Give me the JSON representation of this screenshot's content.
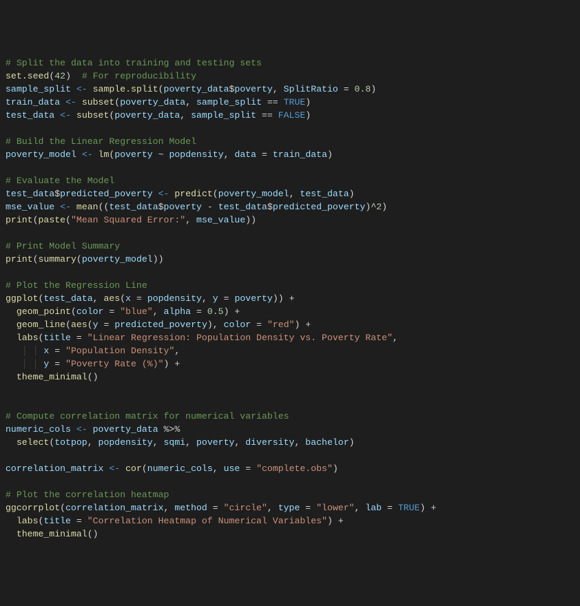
{
  "code": [
    [
      {
        "t": "# Split the data into training and testing sets",
        "c": "comment"
      }
    ],
    [
      {
        "t": "set.seed",
        "c": "func"
      },
      {
        "t": "(",
        "c": "paren"
      },
      {
        "t": "42",
        "c": "num"
      },
      {
        "t": ")",
        "c": "paren"
      },
      {
        "t": "  ",
        "c": "op"
      },
      {
        "t": "# For reproducibility",
        "c": "comment"
      }
    ],
    [
      {
        "t": "sample_split",
        "c": "var"
      },
      {
        "t": " ",
        "c": "op"
      },
      {
        "t": "<-",
        "c": "assign"
      },
      {
        "t": " ",
        "c": "op"
      },
      {
        "t": "sample.split",
        "c": "func"
      },
      {
        "t": "(",
        "c": "paren"
      },
      {
        "t": "poverty_data",
        "c": "var"
      },
      {
        "t": "$",
        "c": "op"
      },
      {
        "t": "poverty",
        "c": "var"
      },
      {
        "t": ", ",
        "c": "op"
      },
      {
        "t": "SplitRatio",
        "c": "var"
      },
      {
        "t": " = ",
        "c": "op"
      },
      {
        "t": "0.8",
        "c": "num"
      },
      {
        "t": ")",
        "c": "paren"
      }
    ],
    [
      {
        "t": "train_data",
        "c": "var"
      },
      {
        "t": " ",
        "c": "op"
      },
      {
        "t": "<-",
        "c": "assign"
      },
      {
        "t": " ",
        "c": "op"
      },
      {
        "t": "subset",
        "c": "func"
      },
      {
        "t": "(",
        "c": "paren"
      },
      {
        "t": "poverty_data",
        "c": "var"
      },
      {
        "t": ", ",
        "c": "op"
      },
      {
        "t": "sample_split",
        "c": "var"
      },
      {
        "t": " == ",
        "c": "op"
      },
      {
        "t": "TRUE",
        "c": "kw"
      },
      {
        "t": ")",
        "c": "paren"
      }
    ],
    [
      {
        "t": "test_data",
        "c": "var"
      },
      {
        "t": " ",
        "c": "op"
      },
      {
        "t": "<-",
        "c": "assign"
      },
      {
        "t": " ",
        "c": "op"
      },
      {
        "t": "subset",
        "c": "func"
      },
      {
        "t": "(",
        "c": "paren"
      },
      {
        "t": "poverty_data",
        "c": "var"
      },
      {
        "t": ", ",
        "c": "op"
      },
      {
        "t": "sample_split",
        "c": "var"
      },
      {
        "t": " == ",
        "c": "op"
      },
      {
        "t": "FALSE",
        "c": "kw"
      },
      {
        "t": ")",
        "c": "paren"
      }
    ],
    [],
    [
      {
        "t": "# Build the Linear Regression Model",
        "c": "comment"
      }
    ],
    [
      {
        "t": "poverty_model",
        "c": "var"
      },
      {
        "t": " ",
        "c": "op"
      },
      {
        "t": "<-",
        "c": "assign"
      },
      {
        "t": " ",
        "c": "op"
      },
      {
        "t": "lm",
        "c": "func"
      },
      {
        "t": "(",
        "c": "paren"
      },
      {
        "t": "poverty",
        "c": "var"
      },
      {
        "t": " ~ ",
        "c": "op"
      },
      {
        "t": "popdensity",
        "c": "var"
      },
      {
        "t": ", ",
        "c": "op"
      },
      {
        "t": "data",
        "c": "var"
      },
      {
        "t": " = ",
        "c": "op"
      },
      {
        "t": "train_data",
        "c": "var"
      },
      {
        "t": ")",
        "c": "paren"
      }
    ],
    [],
    [
      {
        "t": "# Evaluate the Model",
        "c": "comment"
      }
    ],
    [
      {
        "t": "test_data",
        "c": "var"
      },
      {
        "t": "$",
        "c": "op"
      },
      {
        "t": "predicted_poverty",
        "c": "var"
      },
      {
        "t": " ",
        "c": "op"
      },
      {
        "t": "<-",
        "c": "assign"
      },
      {
        "t": " ",
        "c": "op"
      },
      {
        "t": "predict",
        "c": "func"
      },
      {
        "t": "(",
        "c": "paren"
      },
      {
        "t": "poverty_model",
        "c": "var"
      },
      {
        "t": ", ",
        "c": "op"
      },
      {
        "t": "test_data",
        "c": "var"
      },
      {
        "t": ")",
        "c": "paren"
      }
    ],
    [
      {
        "t": "mse_value",
        "c": "var"
      },
      {
        "t": " ",
        "c": "op"
      },
      {
        "t": "<-",
        "c": "assign"
      },
      {
        "t": " ",
        "c": "op"
      },
      {
        "t": "mean",
        "c": "func"
      },
      {
        "t": "((",
        "c": "paren"
      },
      {
        "t": "test_data",
        "c": "var"
      },
      {
        "t": "$",
        "c": "op"
      },
      {
        "t": "poverty",
        "c": "var"
      },
      {
        "t": " - ",
        "c": "op"
      },
      {
        "t": "test_data",
        "c": "var"
      },
      {
        "t": "$",
        "c": "op"
      },
      {
        "t": "predicted_poverty",
        "c": "var"
      },
      {
        "t": ")^",
        "c": "paren"
      },
      {
        "t": "2",
        "c": "num"
      },
      {
        "t": ")",
        "c": "paren"
      }
    ],
    [
      {
        "t": "print",
        "c": "func"
      },
      {
        "t": "(",
        "c": "paren"
      },
      {
        "t": "paste",
        "c": "func"
      },
      {
        "t": "(",
        "c": "paren"
      },
      {
        "t": "\"Mean Squared Error:\"",
        "c": "str"
      },
      {
        "t": ", ",
        "c": "op"
      },
      {
        "t": "mse_value",
        "c": "var"
      },
      {
        "t": "))",
        "c": "paren"
      }
    ],
    [],
    [
      {
        "t": "# Print Model Summary",
        "c": "comment"
      }
    ],
    [
      {
        "t": "print",
        "c": "func"
      },
      {
        "t": "(",
        "c": "paren"
      },
      {
        "t": "summary",
        "c": "func"
      },
      {
        "t": "(",
        "c": "paren"
      },
      {
        "t": "poverty_model",
        "c": "var"
      },
      {
        "t": "))",
        "c": "paren"
      }
    ],
    [],
    [
      {
        "t": "# Plot the Regression Line",
        "c": "comment"
      }
    ],
    [
      {
        "t": "ggplot",
        "c": "func"
      },
      {
        "t": "(",
        "c": "paren"
      },
      {
        "t": "test_data",
        "c": "var"
      },
      {
        "t": ", ",
        "c": "op"
      },
      {
        "t": "aes",
        "c": "func"
      },
      {
        "t": "(",
        "c": "paren"
      },
      {
        "t": "x",
        "c": "var"
      },
      {
        "t": " = ",
        "c": "op"
      },
      {
        "t": "popdensity",
        "c": "var"
      },
      {
        "t": ", ",
        "c": "op"
      },
      {
        "t": "y",
        "c": "var"
      },
      {
        "t": " = ",
        "c": "op"
      },
      {
        "t": "poverty",
        "c": "var"
      },
      {
        "t": ")) +",
        "c": "paren"
      }
    ],
    [
      {
        "t": "  ",
        "c": "op"
      },
      {
        "t": "geom_point",
        "c": "func"
      },
      {
        "t": "(",
        "c": "paren"
      },
      {
        "t": "color",
        "c": "var"
      },
      {
        "t": " = ",
        "c": "op"
      },
      {
        "t": "\"blue\"",
        "c": "str"
      },
      {
        "t": ", ",
        "c": "op"
      },
      {
        "t": "alpha",
        "c": "var"
      },
      {
        "t": " = ",
        "c": "op"
      },
      {
        "t": "0.5",
        "c": "num"
      },
      {
        "t": ") +",
        "c": "paren"
      }
    ],
    [
      {
        "t": "  ",
        "c": "op"
      },
      {
        "t": "geom_line",
        "c": "func"
      },
      {
        "t": "(",
        "c": "paren"
      },
      {
        "t": "aes",
        "c": "func"
      },
      {
        "t": "(",
        "c": "paren"
      },
      {
        "t": "y",
        "c": "var"
      },
      {
        "t": " = ",
        "c": "op"
      },
      {
        "t": "predicted_poverty",
        "c": "var"
      },
      {
        "t": "), ",
        "c": "paren"
      },
      {
        "t": "color",
        "c": "var"
      },
      {
        "t": " = ",
        "c": "op"
      },
      {
        "t": "\"red\"",
        "c": "str"
      },
      {
        "t": ") +",
        "c": "paren"
      }
    ],
    [
      {
        "t": "  ",
        "c": "op"
      },
      {
        "t": "labs",
        "c": "func"
      },
      {
        "t": "(",
        "c": "paren"
      },
      {
        "t": "title",
        "c": "var"
      },
      {
        "t": " = ",
        "c": "op"
      },
      {
        "t": "\"Linear Regression: Population Density vs. Poverty Rate\"",
        "c": "str"
      },
      {
        "t": ",",
        "c": "paren"
      }
    ],
    [
      {
        "t": "   ",
        "c": "op"
      },
      {
        "t": "│ │ ",
        "c": "guide"
      },
      {
        "t": "x",
        "c": "var"
      },
      {
        "t": " = ",
        "c": "op"
      },
      {
        "t": "\"Population Density\"",
        "c": "str"
      },
      {
        "t": ",",
        "c": "paren"
      }
    ],
    [
      {
        "t": "   ",
        "c": "op"
      },
      {
        "t": "│ │ ",
        "c": "guide"
      },
      {
        "t": "y",
        "c": "var"
      },
      {
        "t": " = ",
        "c": "op"
      },
      {
        "t": "\"Poverty Rate (%)\"",
        "c": "str"
      },
      {
        "t": ") +",
        "c": "paren"
      }
    ],
    [
      {
        "t": "  ",
        "c": "op"
      },
      {
        "t": "theme_minimal",
        "c": "func"
      },
      {
        "t": "()",
        "c": "paren"
      }
    ],
    [],
    [],
    [
      {
        "t": "# Compute correlation matrix for numerical variables",
        "c": "comment"
      }
    ],
    [
      {
        "t": "numeric_cols",
        "c": "var"
      },
      {
        "t": " ",
        "c": "op"
      },
      {
        "t": "<-",
        "c": "assign"
      },
      {
        "t": " ",
        "c": "op"
      },
      {
        "t": "poverty_data",
        "c": "var"
      },
      {
        "t": " %>%",
        "c": "op"
      }
    ],
    [
      {
        "t": "  ",
        "c": "op"
      },
      {
        "t": "select",
        "c": "func"
      },
      {
        "t": "(",
        "c": "paren"
      },
      {
        "t": "totpop",
        "c": "var"
      },
      {
        "t": ", ",
        "c": "op"
      },
      {
        "t": "popdensity",
        "c": "var"
      },
      {
        "t": ", ",
        "c": "op"
      },
      {
        "t": "sqmi",
        "c": "var"
      },
      {
        "t": ", ",
        "c": "op"
      },
      {
        "t": "poverty",
        "c": "var"
      },
      {
        "t": ", ",
        "c": "op"
      },
      {
        "t": "diversity",
        "c": "var"
      },
      {
        "t": ", ",
        "c": "op"
      },
      {
        "t": "bachelor",
        "c": "var"
      },
      {
        "t": ")",
        "c": "paren"
      }
    ],
    [],
    [
      {
        "t": "correlation_matrix",
        "c": "var"
      },
      {
        "t": " ",
        "c": "op"
      },
      {
        "t": "<-",
        "c": "assign"
      },
      {
        "t": " ",
        "c": "op"
      },
      {
        "t": "cor",
        "c": "func"
      },
      {
        "t": "(",
        "c": "paren"
      },
      {
        "t": "numeric_cols",
        "c": "var"
      },
      {
        "t": ", ",
        "c": "op"
      },
      {
        "t": "use",
        "c": "var"
      },
      {
        "t": " = ",
        "c": "op"
      },
      {
        "t": "\"complete.obs\"",
        "c": "str"
      },
      {
        "t": ")",
        "c": "paren"
      }
    ],
    [],
    [
      {
        "t": "# Plot the correlation heatmap",
        "c": "comment"
      }
    ],
    [
      {
        "t": "ggcorrplot",
        "c": "func"
      },
      {
        "t": "(",
        "c": "paren"
      },
      {
        "t": "correlation_matrix",
        "c": "var"
      },
      {
        "t": ", ",
        "c": "op"
      },
      {
        "t": "method",
        "c": "var"
      },
      {
        "t": " = ",
        "c": "op"
      },
      {
        "t": "\"circle\"",
        "c": "str"
      },
      {
        "t": ", ",
        "c": "op"
      },
      {
        "t": "type",
        "c": "var"
      },
      {
        "t": " = ",
        "c": "op"
      },
      {
        "t": "\"lower\"",
        "c": "str"
      },
      {
        "t": ", ",
        "c": "op"
      },
      {
        "t": "lab",
        "c": "var"
      },
      {
        "t": " = ",
        "c": "op"
      },
      {
        "t": "TRUE",
        "c": "kw"
      },
      {
        "t": ") +",
        "c": "paren"
      }
    ],
    [
      {
        "t": "  ",
        "c": "op"
      },
      {
        "t": "labs",
        "c": "func"
      },
      {
        "t": "(",
        "c": "paren"
      },
      {
        "t": "title",
        "c": "var"
      },
      {
        "t": " = ",
        "c": "op"
      },
      {
        "t": "\"Correlation Heatmap of Numerical Variables\"",
        "c": "str"
      },
      {
        "t": ") +",
        "c": "paren"
      }
    ],
    [
      {
        "t": "  ",
        "c": "op"
      },
      {
        "t": "theme_minimal",
        "c": "func"
      },
      {
        "t": "()",
        "c": "paren"
      }
    ]
  ]
}
